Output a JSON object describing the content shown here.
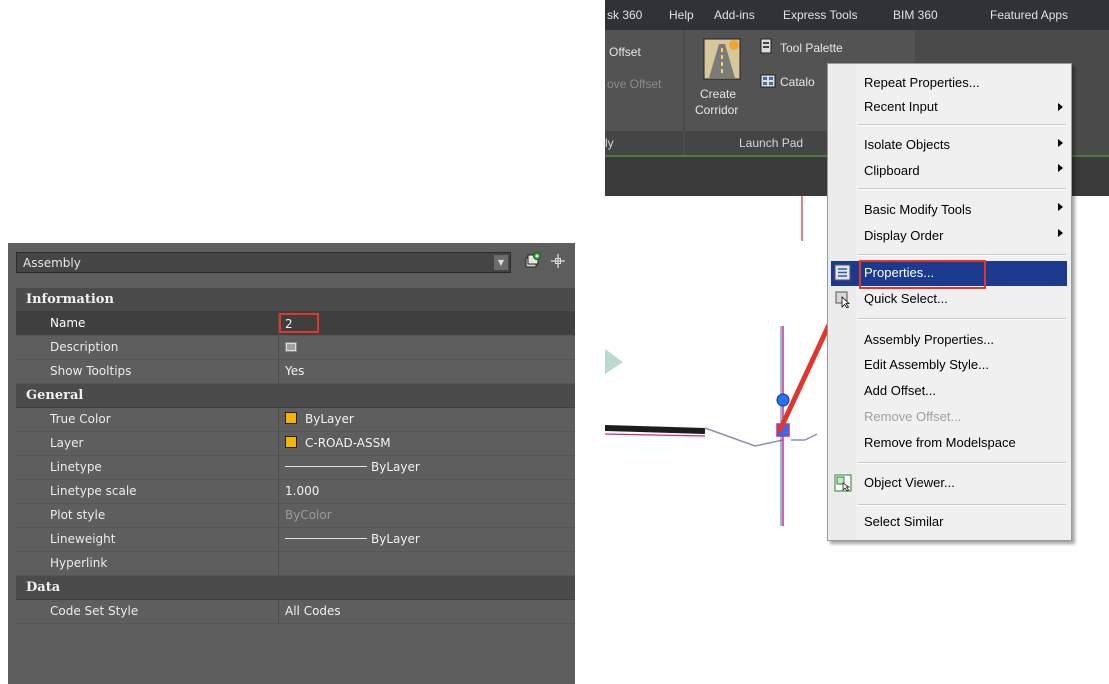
{
  "properties_palette": {
    "object_type": "Assembly",
    "categories": [
      {
        "name": "Information",
        "rows": [
          {
            "key": "Name",
            "value": "2"
          },
          {
            "key": "Description",
            "value": ""
          },
          {
            "key": "Show Tooltips",
            "value": "Yes"
          }
        ]
      },
      {
        "name": "General",
        "rows": [
          {
            "key": "True Color",
            "value": "ByLayer"
          },
          {
            "key": "Layer",
            "value": "C-ROAD-ASSM"
          },
          {
            "key": "Linetype",
            "value": "ByLayer"
          },
          {
            "key": "Linetype scale",
            "value": "1.000"
          },
          {
            "key": "Plot style",
            "value": "ByColor"
          },
          {
            "key": "Lineweight",
            "value": "ByLayer"
          },
          {
            "key": "Hyperlink",
            "value": ""
          }
        ]
      },
      {
        "name": "Data",
        "rows": [
          {
            "key": "Code Set Style",
            "value": "All Codes"
          }
        ]
      }
    ],
    "swatch_color": "#f3b500"
  },
  "menubar": {
    "items": [
      "sk 360",
      "Help",
      "Add-ins",
      "Express Tools",
      "BIM 360",
      "Featured Apps"
    ]
  },
  "ribbon": {
    "offset_label": "Offset",
    "remove_offset_label": "ove Offset",
    "create_corridor_line1": "Create",
    "create_corridor_line2": "Corridor",
    "tool_palette_label": "Tool Palette",
    "catalog_label": "Catalo",
    "panel_left_label": "ly",
    "launch_pad_label": "Launch Pad"
  },
  "context_menu": {
    "repeat_properties": "Repeat Properties...",
    "recent_input": "Recent Input",
    "isolate_objects": "Isolate Objects",
    "clipboard": "Clipboard",
    "basic_modify_tools": "Basic Modify Tools",
    "display_order": "Display Order",
    "properties": "Properties...",
    "quick_select": "Quick Select...",
    "assembly_properties": "Assembly Properties...",
    "edit_assembly_style": "Edit Assembly Style...",
    "add_offset": "Add Offset...",
    "remove_offset": "Remove Offset...",
    "remove_from_modelspace": "Remove from Modelspace",
    "object_viewer": "Object Viewer...",
    "select_similar": "Select Similar"
  },
  "colors": {
    "highlight": "#1c3a8e",
    "annotation_red": "#e2362c",
    "layer_yellow": "#f3b500"
  }
}
